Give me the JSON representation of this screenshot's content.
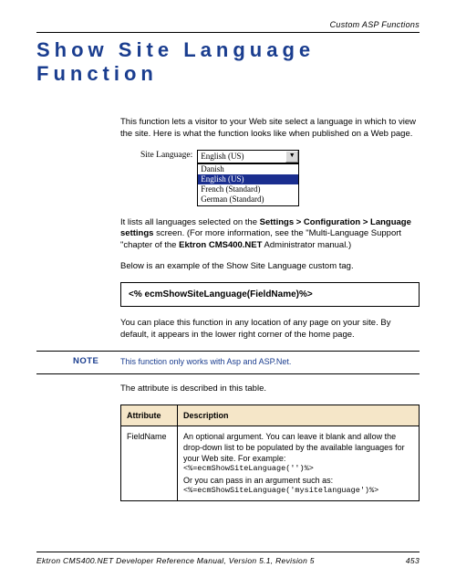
{
  "header": {
    "section": "Custom ASP Functions"
  },
  "title": "Show Site Language Function",
  "intro": "This function lets a visitor to your Web site select a language in which to view the site. Here is what the function looks like when published on a Web page.",
  "dropdown": {
    "label": "Site Language:",
    "selected": "English (US)",
    "items": [
      "Danish",
      "English (US)",
      "French (Standard)",
      "German (Standard)"
    ],
    "selected_index": 1
  },
  "para2_pre": "It lists all languages selected on the ",
  "para2_bold": "Settings > Configuration > Language settings",
  "para2_mid": " screen. (For more information, see the \"Multi-Language Support \"chapter of the ",
  "para2_bold2": "Ektron CMS400.NET",
  "para2_post": " Administrator manual.)",
  "para3": "Below is an example of the Show Site Language custom tag.",
  "code_tag": "<% ecmShowSiteLanguage(FieldName)%>",
  "para4": "You can place this function in any location of any page on your site. By default, it appears in the lower right corner of the home page.",
  "note": {
    "label": "NOTE",
    "text": "This function only works with Asp and ASP.Net."
  },
  "para5": "The attribute is described in this table.",
  "table": {
    "headers": [
      "Attribute",
      "Description"
    ],
    "row": {
      "name": "FieldName",
      "desc1": "An optional argument. You can leave it blank and allow the drop-down list to be populated by the available languages for your Web site. For example:",
      "code1": "<%=ecmShowSiteLanguage('')%>",
      "desc2": "Or you can pass in an argument such as:",
      "code2": "<%=ecmShowSiteLanguage('mysitelanguage')%>"
    }
  },
  "footer": {
    "left": "Ektron CMS400.NET Developer Reference Manual, Version 5.1, Revision 5",
    "right": "453"
  }
}
